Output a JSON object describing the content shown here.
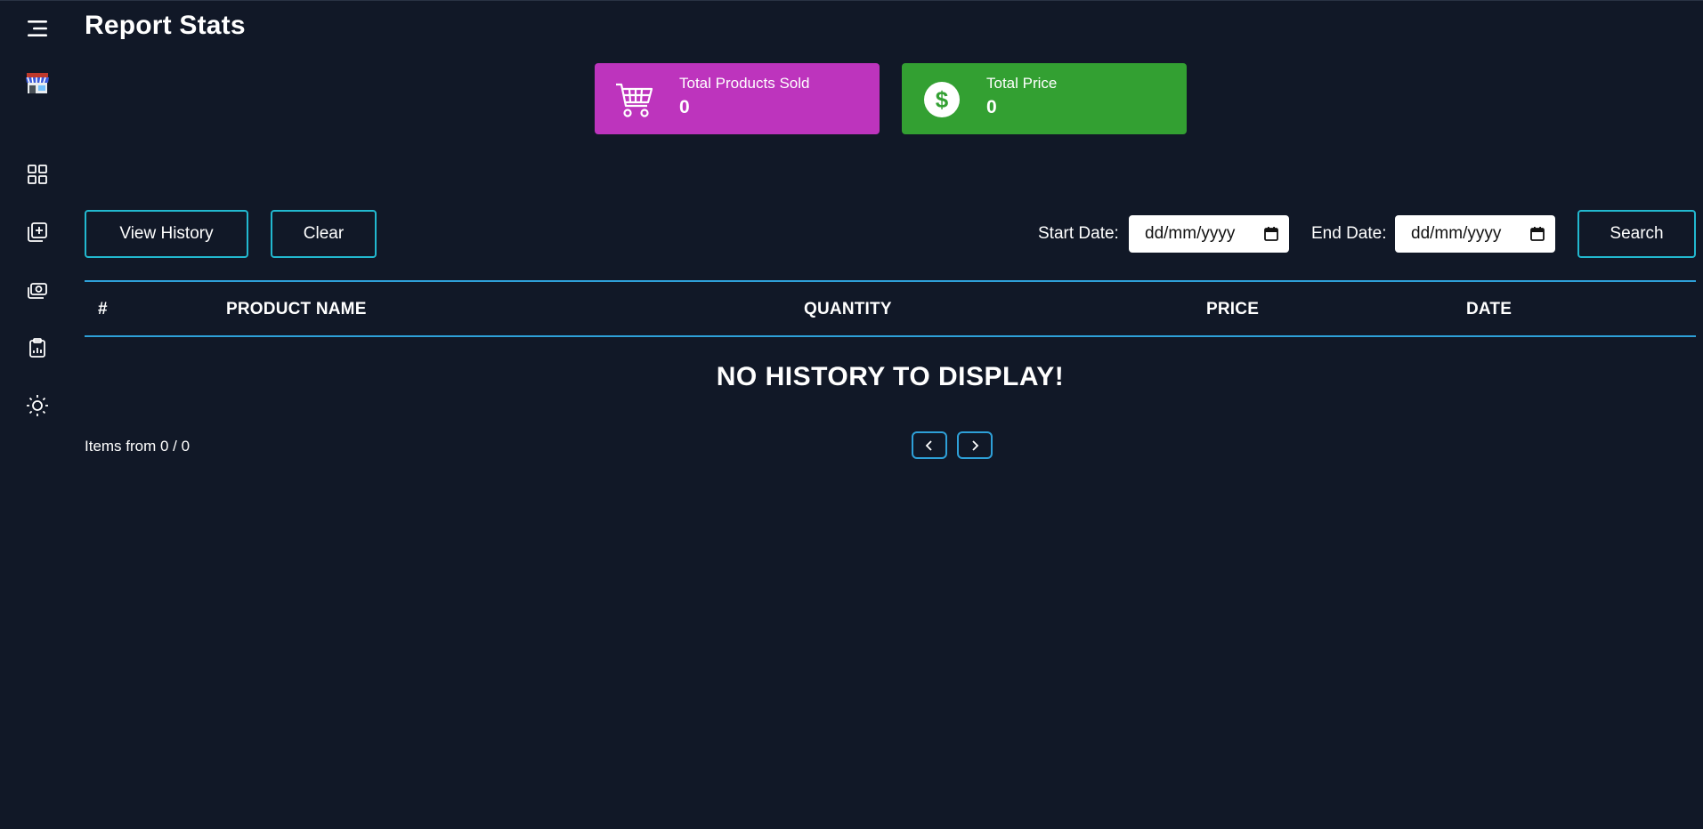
{
  "page": {
    "title": "Report Stats"
  },
  "sidebar": {
    "icons": [
      "menu-icon",
      "store-icon",
      "dashboard-icon",
      "add-product-icon",
      "sales-icon",
      "report-icon",
      "theme-toggle-icon"
    ]
  },
  "stats": {
    "products_sold": {
      "label": "Total Products Sold",
      "value": "0",
      "color": "#bd34bd"
    },
    "total_price": {
      "label": "Total Price",
      "value": "0",
      "color": "#33a032"
    }
  },
  "toolbar": {
    "view_history_label": "View History",
    "clear_label": "Clear",
    "start_date_label": "Start Date:",
    "start_date_value": "dd/mm/yyyy",
    "end_date_label": "End Date:",
    "end_date_value": "dd/mm/yyyy",
    "search_label": "Search"
  },
  "table": {
    "columns": [
      "#",
      "PRODUCT NAME",
      "QUANTITY",
      "PRICE",
      "DATE"
    ],
    "empty_message": "NO HISTORY TO DISPLAY!"
  },
  "pagination": {
    "items_info": "Items from 0 / 0"
  },
  "colors": {
    "background": "#111827",
    "accent": "#22b8cf",
    "table_line": "#2ea0d8"
  }
}
